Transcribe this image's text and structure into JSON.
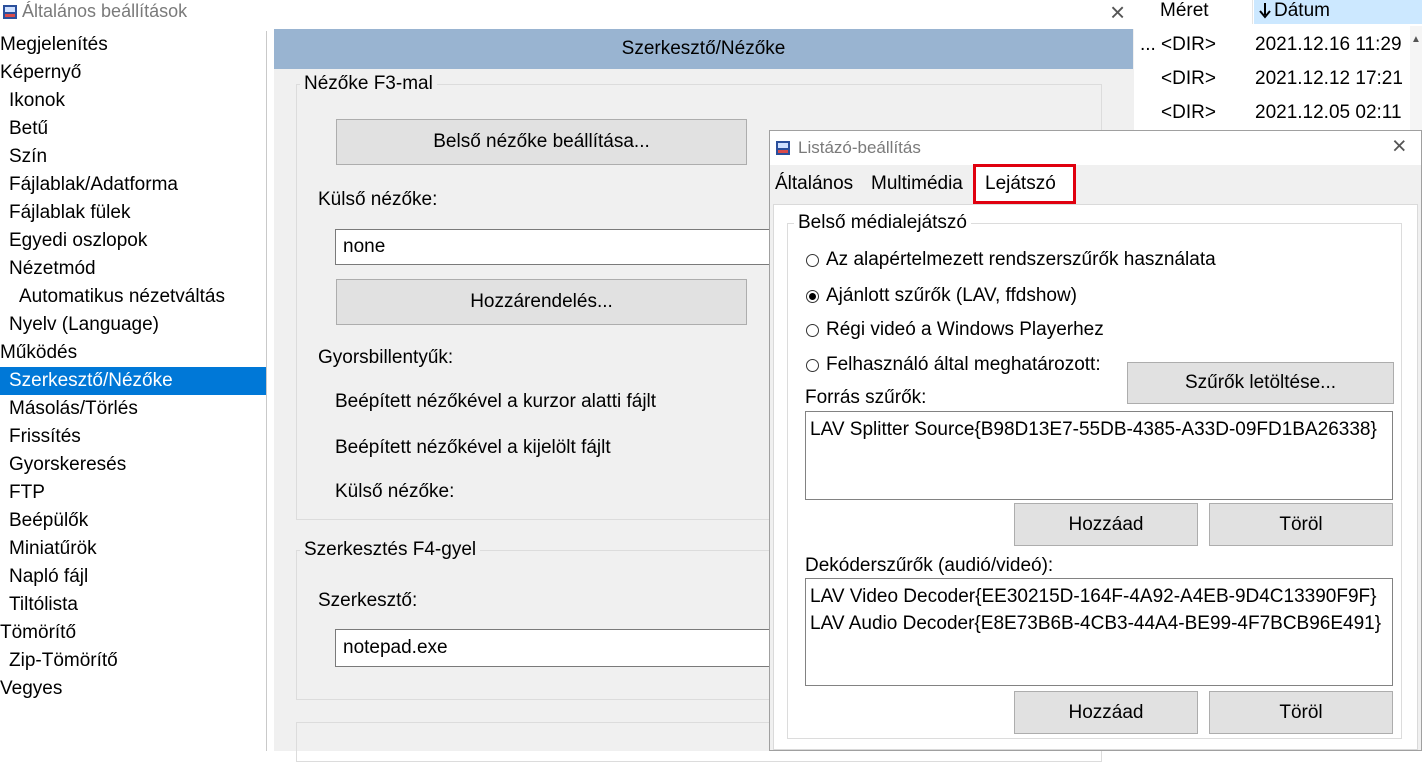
{
  "main_window": {
    "title": "Általános beállítások",
    "close_glyph": "×",
    "section_header": "Szerkesztő/Nézőke"
  },
  "sidebar": {
    "items": [
      {
        "label": "Megjelenítés",
        "level": 0
      },
      {
        "label": "Képernyő",
        "level": 0
      },
      {
        "label": "Ikonok",
        "level": 1
      },
      {
        "label": "Betű",
        "level": 1
      },
      {
        "label": "Szín",
        "level": 1
      },
      {
        "label": "Fájlablak/Adatforma",
        "level": 1
      },
      {
        "label": "Fájlablak fülek",
        "level": 1
      },
      {
        "label": "Egyedi oszlopok",
        "level": 1
      },
      {
        "label": "Nézetmód",
        "level": 1
      },
      {
        "label": "Automatikus nézetváltás",
        "level": 2
      },
      {
        "label": "Nyelv (Language)",
        "level": 1
      },
      {
        "label": "Működés",
        "level": 0
      },
      {
        "label": "Szerkesztő/Nézőke",
        "level": 1,
        "selected": true
      },
      {
        "label": "Másolás/Törlés",
        "level": 1
      },
      {
        "label": "Frissítés",
        "level": 1
      },
      {
        "label": "Gyorskeresés",
        "level": 1
      },
      {
        "label": "FTP",
        "level": 1
      },
      {
        "label": "Beépülők",
        "level": 1
      },
      {
        "label": "Miniatűrök",
        "level": 1
      },
      {
        "label": "Napló fájl",
        "level": 1
      },
      {
        "label": "Tiltólista",
        "level": 1
      },
      {
        "label": "Tömörítő",
        "level": 0
      },
      {
        "label": "Zip-Tömörítő",
        "level": 1
      },
      {
        "label": "Vegyes",
        "level": 0
      }
    ]
  },
  "viewer_group": {
    "title": "Nézőke F3-mal",
    "internal_button": "Belső nézőke beállítása...",
    "external_label": "Külső nézőke:",
    "external_value": "none",
    "assign_button": "Hozzárendelés...",
    "hotkeys_label": "Gyorsbillentyűk:",
    "hotkey1": "Beépített nézőkével a kurzor alatti fájlt",
    "hotkey2": "Beépített nézőkével a kijelölt fájlt",
    "hotkey3": "Külső nézőke:"
  },
  "editor_group": {
    "title": "Szerkesztés F4-gyel",
    "label": "Szerkesztő:",
    "value": "notepad.exe"
  },
  "file_list": {
    "columns": [
      "Méret",
      "Dátum"
    ],
    "sort_arrow": "🡣",
    "rows": [
      {
        "size": "<DIR>",
        "date": "2021.12.16 11:29"
      },
      {
        "size": "<DIR>",
        "date": "2021.12.12 17:21"
      },
      {
        "size": "<DIR>",
        "date": "2021.12.05 02:11"
      }
    ],
    "ellipsis": "..."
  },
  "dialog": {
    "title": "Listázó-beállítás",
    "close_glyph": "×",
    "tabs": [
      "Általános",
      "Multimédia",
      "Lejátszó"
    ],
    "active_tab": "Lejátszó",
    "highlight_color": "#e0000f",
    "group_title": "Belső médialejátszó",
    "radios": [
      {
        "label": "Az alapértelmezett rendszerszűrők használata",
        "checked": false
      },
      {
        "label": "Ajánlott szűrők (LAV, ffdshow)",
        "checked": true
      },
      {
        "label": "Régi videó a Windows Playerhez",
        "checked": false
      },
      {
        "label": "Felhasználó által meghatározott:",
        "checked": false
      }
    ],
    "download_button": "Szűrők letöltése...",
    "source_label": "Forrás szűrők:",
    "source_items": [
      "LAV Splitter Source{B98D13E7-55DB-4385-A33D-09FD1BA26338}"
    ],
    "add_button": "Hozzáad",
    "remove_button": "Töröl",
    "decoder_label": "Dekóderszűrők (audió/videó):",
    "decoder_items": [
      "LAV Video Decoder{EE30215D-164F-4A92-A4EB-9D4C13390F9F}",
      "LAV Audio Decoder{E8E73B6B-4CB3-44A4-BE99-4F7BCB96E491}"
    ]
  },
  "colors": {
    "selection": "#0078d7",
    "header_bar": "#99b4d1",
    "dialog_bg": "#f0f0f0"
  }
}
